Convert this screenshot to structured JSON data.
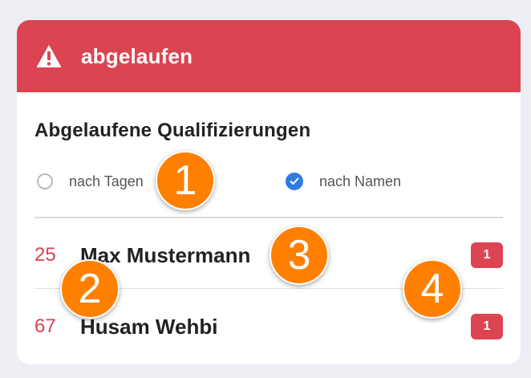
{
  "header": {
    "title": "abgelaufen",
    "icon": "warning-icon",
    "color": "#dc4452"
  },
  "section": {
    "title": "Abgelaufene Qualifizierungen"
  },
  "sort_options": [
    {
      "label": "nach Tagen",
      "selected": false
    },
    {
      "label": "nach Namen",
      "selected": true
    }
  ],
  "rows": [
    {
      "days": "25",
      "name": "Max Mustermann",
      "count": "1"
    },
    {
      "days": "67",
      "name": "Husam Wehbi",
      "count": "1"
    }
  ],
  "markers": [
    "1",
    "2",
    "3",
    "4"
  ],
  "colors": {
    "accent": "#dc4452",
    "radio_checked": "#2f7be0",
    "marker": "#ff8000"
  }
}
